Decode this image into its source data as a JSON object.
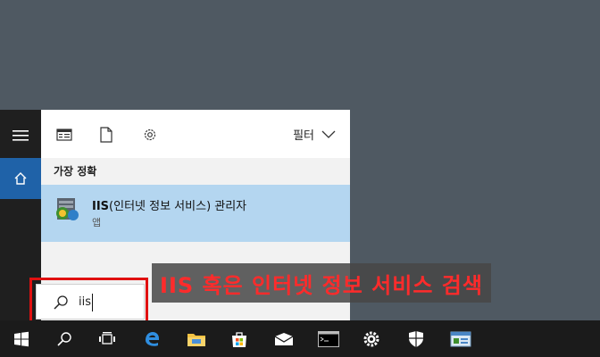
{
  "panel": {
    "filter_label": "필터",
    "section_title": "가장 정확",
    "result": {
      "title_bold": "IIS",
      "title_rest": "(인터넷 정보 서비스) 관리자",
      "subtitle": "앱"
    }
  },
  "search": {
    "value": "iis"
  },
  "annotation": {
    "text": "IIS 혹은 인터넷 정보 서비스 검색",
    "color": "#ff2b2b"
  },
  "colors": {
    "accent": "#1f62a8",
    "highlight": "#b4d6f0",
    "taskbar": "#1b1b1b",
    "desktop": "#4f5962"
  },
  "taskbar": {
    "icons": [
      "windows-start-icon",
      "search-icon",
      "task-view-icon",
      "edge-icon",
      "file-explorer-icon",
      "store-icon",
      "mail-icon",
      "command-prompt-icon",
      "settings-gear-icon",
      "windows-defender-icon",
      "iis-manager-icon"
    ]
  }
}
